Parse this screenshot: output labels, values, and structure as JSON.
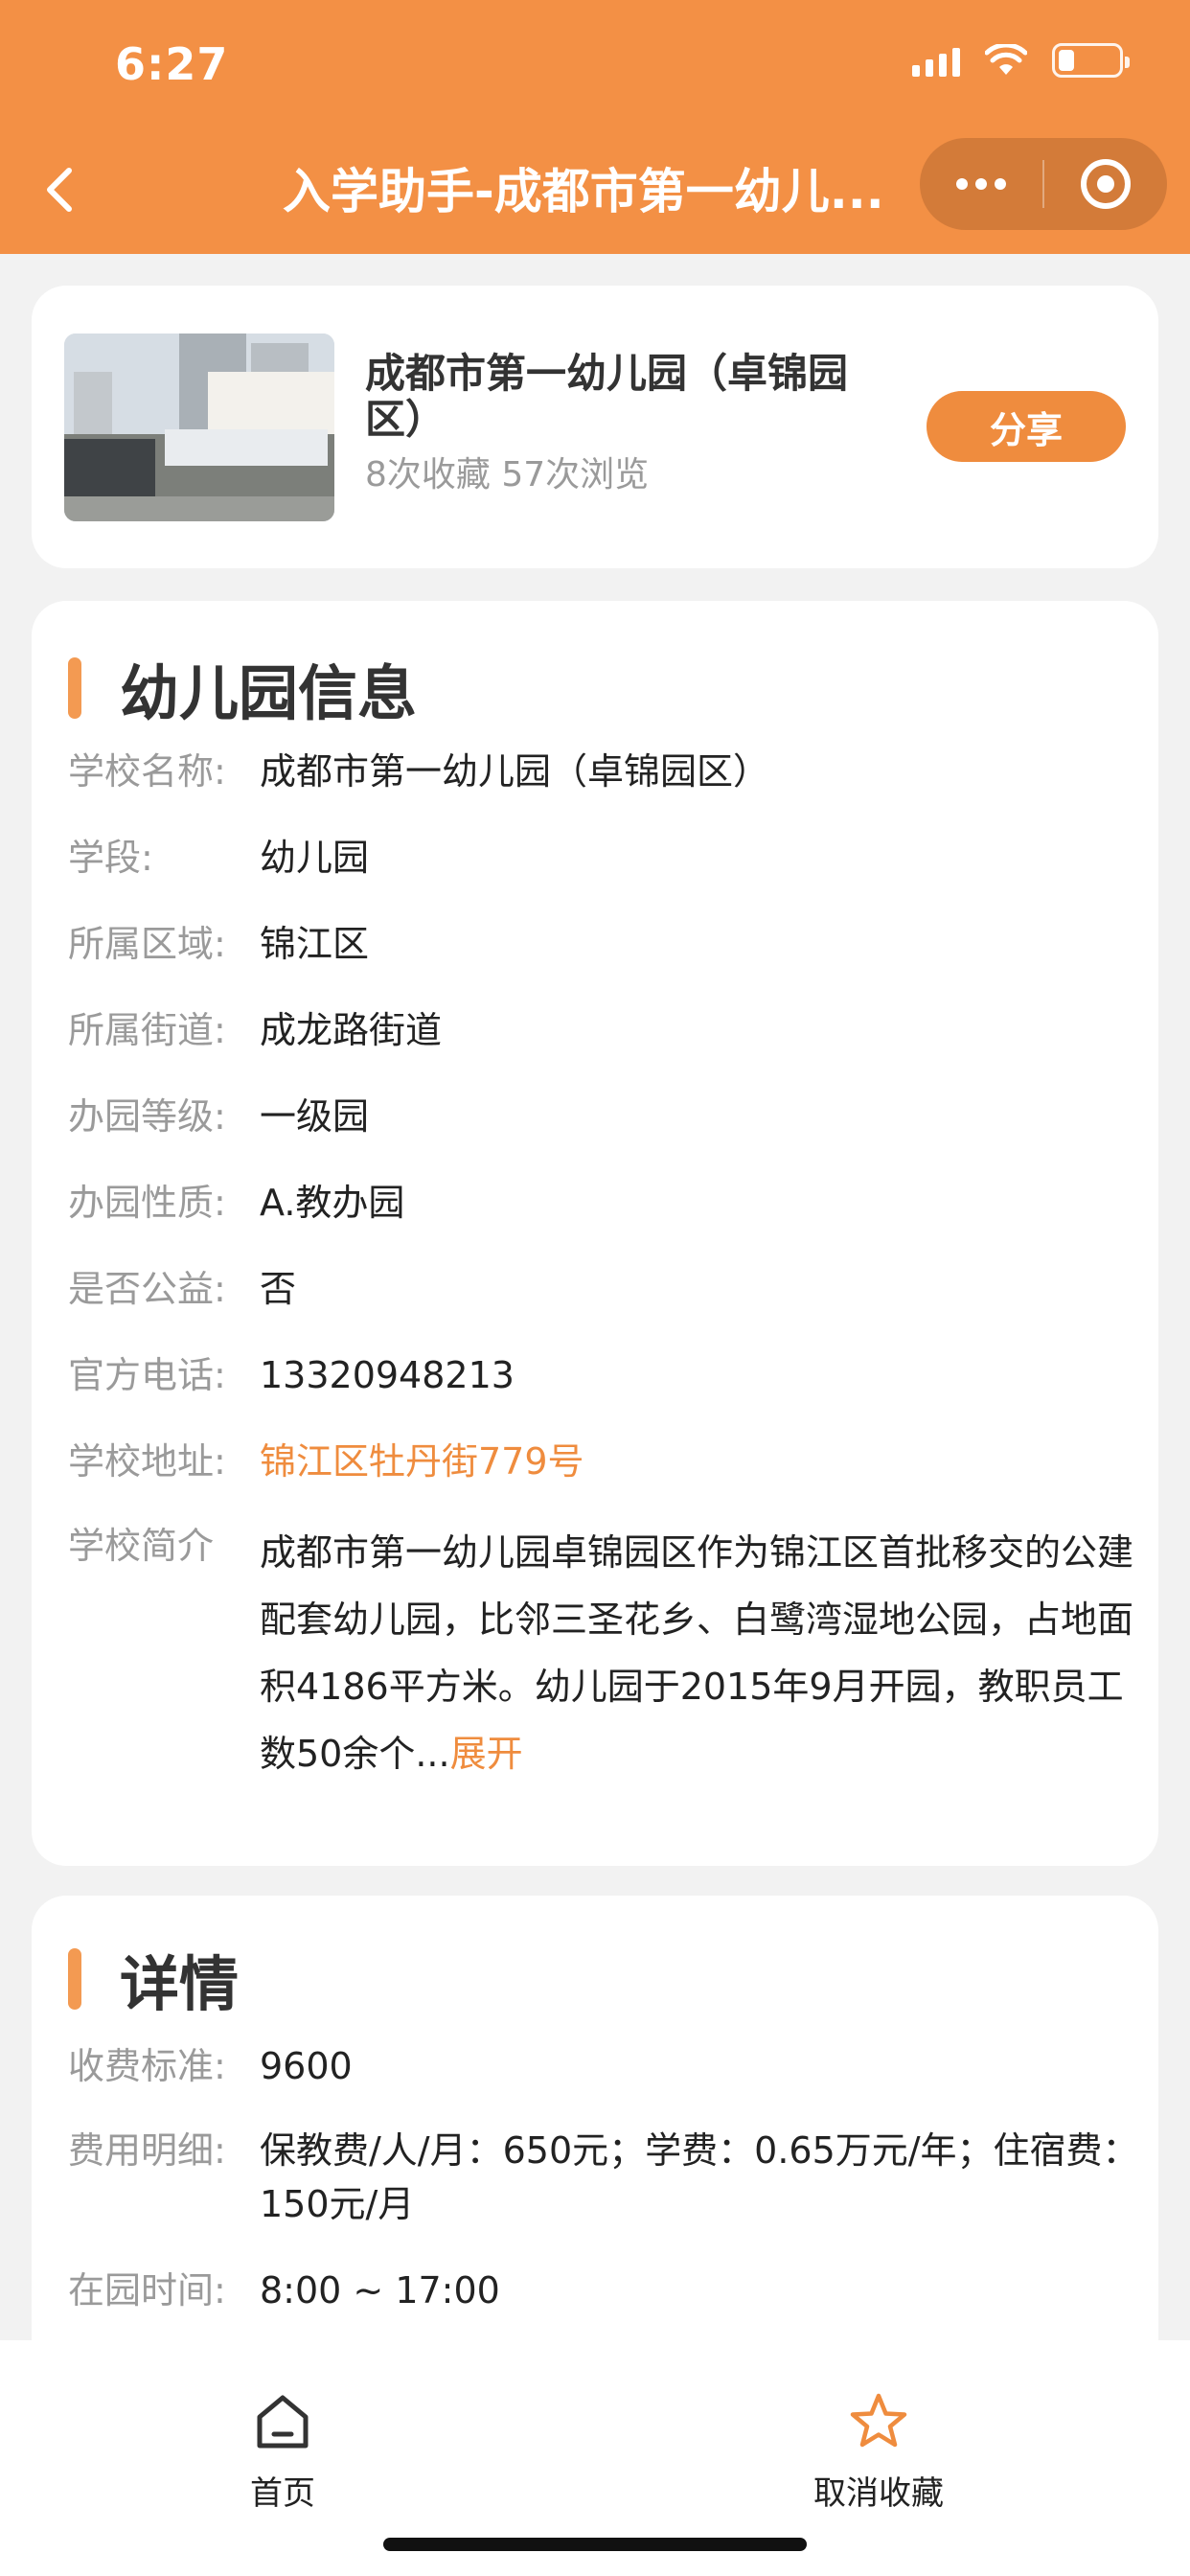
{
  "status_bar": {
    "time": "6:27",
    "battery_level": 0.26
  },
  "nav": {
    "title": "入学助手-成都市第一幼儿..."
  },
  "school": {
    "name": "成都市第一幼儿园（卓锦园区）",
    "stats": "8次收藏 57次浏览",
    "share_label": "分享"
  },
  "info_section": {
    "title": "幼儿园信息",
    "rows": [
      {
        "label": "学校名称:",
        "value": "成都市第一幼儿园（卓锦园区）"
      },
      {
        "label": "学段:",
        "value": "幼儿园"
      },
      {
        "label": "所属区域:",
        "value": "锦江区"
      },
      {
        "label": "所属街道:",
        "value": "成龙路街道"
      },
      {
        "label": "办园等级:",
        "value": "一级园"
      },
      {
        "label": "办园性质:",
        "value": "A.教办园"
      },
      {
        "label": "是否公益:",
        "value": "否"
      },
      {
        "label": "官方电话:",
        "value": "13320948213"
      },
      {
        "label": "学校地址:",
        "value": "锦江区牡丹街779号"
      }
    ],
    "intro": {
      "label": "学校简介",
      "text": "成都市第一幼儿园卓锦园区作为锦江区首批移交的公建配套幼儿园，比邻三圣花乡、白鹭湾湿地公园，占地面积4186平方米。幼儿园于2015年9月开园，教职员工数50余个...",
      "expand": "展开"
    }
  },
  "details_section": {
    "title": "详情",
    "rows": [
      {
        "label": "收费标准:",
        "value": "9600"
      },
      {
        "label": "费用明细:",
        "value": "保教费/人/月：650元；学费：0.65万元/年；住宿费：150元/月"
      },
      {
        "label": "在园时间:",
        "value": "8:00 ~ 17:00"
      }
    ]
  },
  "tabbar": {
    "home_label": "首页",
    "fav_label": "取消收藏"
  },
  "colors": {
    "accent": "#f39045",
    "link": "#ef8c3e"
  },
  "icons": [
    "back-icon",
    "more-icon",
    "close-capsule-icon",
    "home-icon",
    "star-icon"
  ]
}
